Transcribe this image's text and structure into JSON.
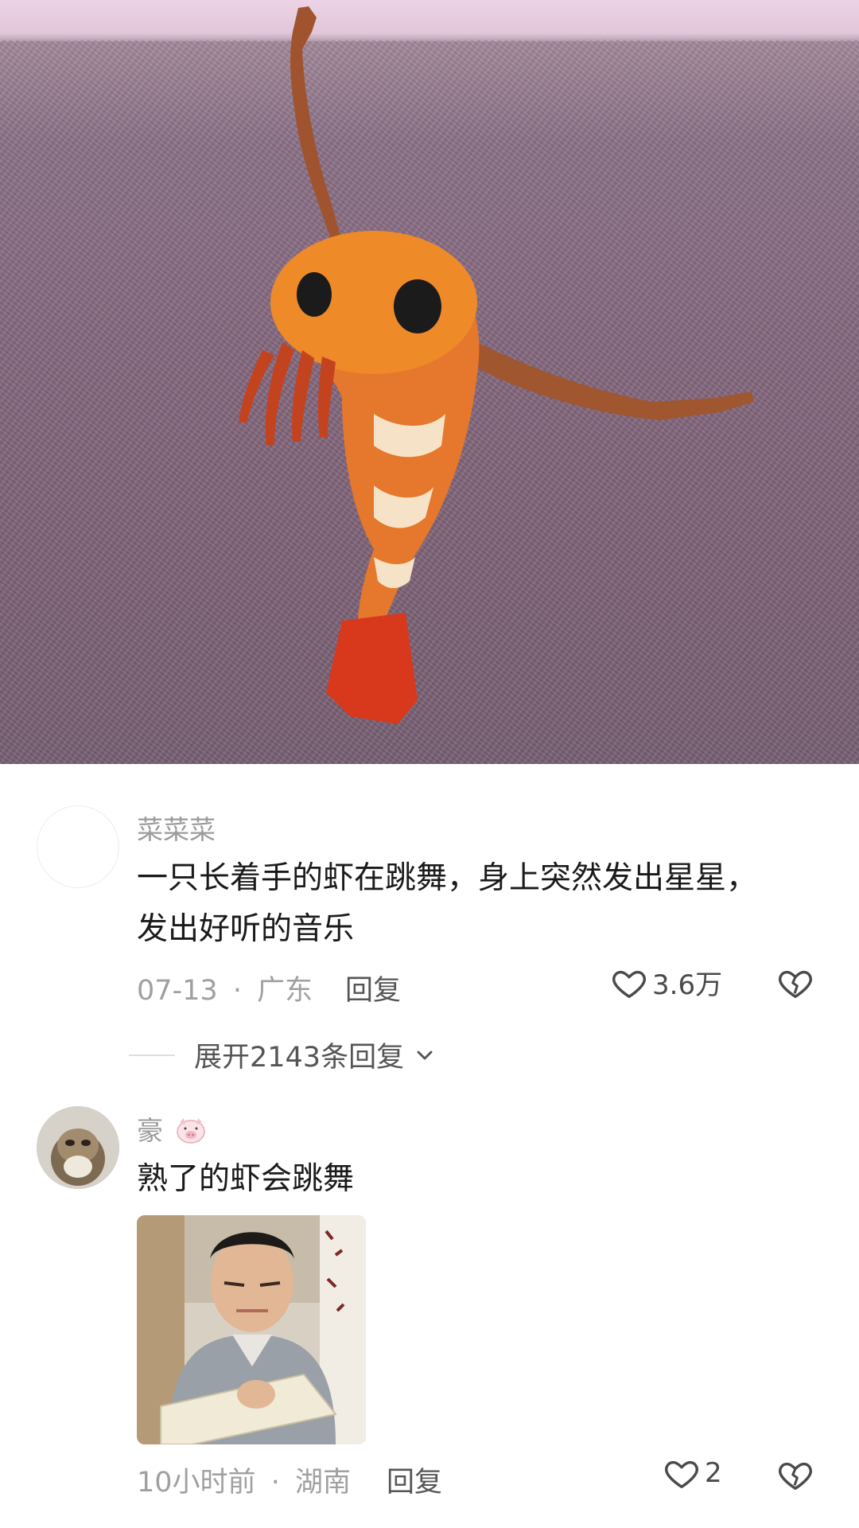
{
  "comments": [
    {
      "username": "菜菜菜",
      "text_line1": "一只长着手的虾在跳舞，身上突然发出星星，",
      "text_line2": "发出好听的音乐",
      "time": "07-13",
      "separator": "·",
      "location": "广东",
      "reply_label": "回复",
      "likes": "3.6万",
      "expand_replies": "展开2143条回复"
    },
    {
      "username": "豪",
      "text": "熟了的虾会跳舞",
      "time": "10小时前",
      "separator": "·",
      "location": "湖南",
      "reply_label": "回复",
      "likes": "2"
    }
  ],
  "icons": {
    "like": "heart-outline-icon",
    "dislike": "broken-heart-icon",
    "expand": "chevron-down-icon",
    "badge": "pig-emoji-icon"
  },
  "colors": {
    "primary_text": "#1a1a1a",
    "secondary_text": "#a0a0a0",
    "action_text": "#555555"
  }
}
